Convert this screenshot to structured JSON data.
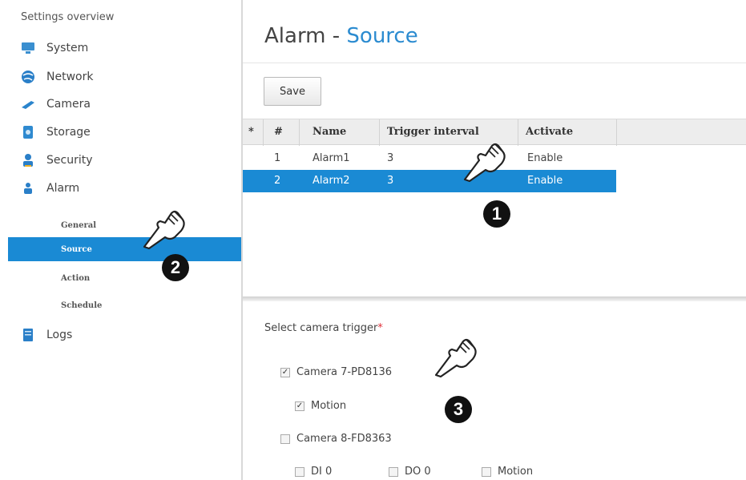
{
  "sidebar": {
    "title": "Settings overview",
    "items": [
      {
        "label": "System",
        "icon": "system-icon"
      },
      {
        "label": "Network",
        "icon": "network-icon"
      },
      {
        "label": "Camera",
        "icon": "camera-icon"
      },
      {
        "label": "Storage",
        "icon": "storage-icon"
      },
      {
        "label": "Security",
        "icon": "security-icon"
      },
      {
        "label": "Alarm",
        "icon": "alarm-icon"
      },
      {
        "label": "Logs",
        "icon": "logs-icon"
      }
    ],
    "alarm_sub": [
      "General",
      "Source",
      "Action",
      "Schedule"
    ],
    "active_sub": "Source"
  },
  "page": {
    "title_main": "Alarm - ",
    "title_accent": "Source"
  },
  "toolbar": {
    "save_label": "Save"
  },
  "grid": {
    "columns": [
      "*",
      "#",
      "Name",
      "Trigger interval",
      "Activate"
    ],
    "rows": [
      {
        "num": "1",
        "name": "Alarm1",
        "interval": "3",
        "activate": "Enable",
        "selected": false
      },
      {
        "num": "2",
        "name": "Alarm2",
        "interval": "3",
        "activate": "Enable",
        "selected": true
      }
    ]
  },
  "trigger": {
    "label": "Select camera trigger",
    "required_mark": "*",
    "cameras": [
      {
        "label": "Camera 7-PD8136",
        "checked": true,
        "options": [
          {
            "label": "Motion",
            "checked": true
          }
        ]
      },
      {
        "label": "Camera 8-FD8363",
        "checked": false,
        "options": [
          {
            "label": "DI 0",
            "checked": false
          },
          {
            "label": "DO 0",
            "checked": false
          },
          {
            "label": "Motion",
            "checked": false
          }
        ]
      }
    ]
  },
  "annotations": [
    "1",
    "2",
    "3"
  ],
  "colors": {
    "accent": "#1a8ad4",
    "title_accent": "#2b8bd0",
    "required": "#e0303a"
  }
}
